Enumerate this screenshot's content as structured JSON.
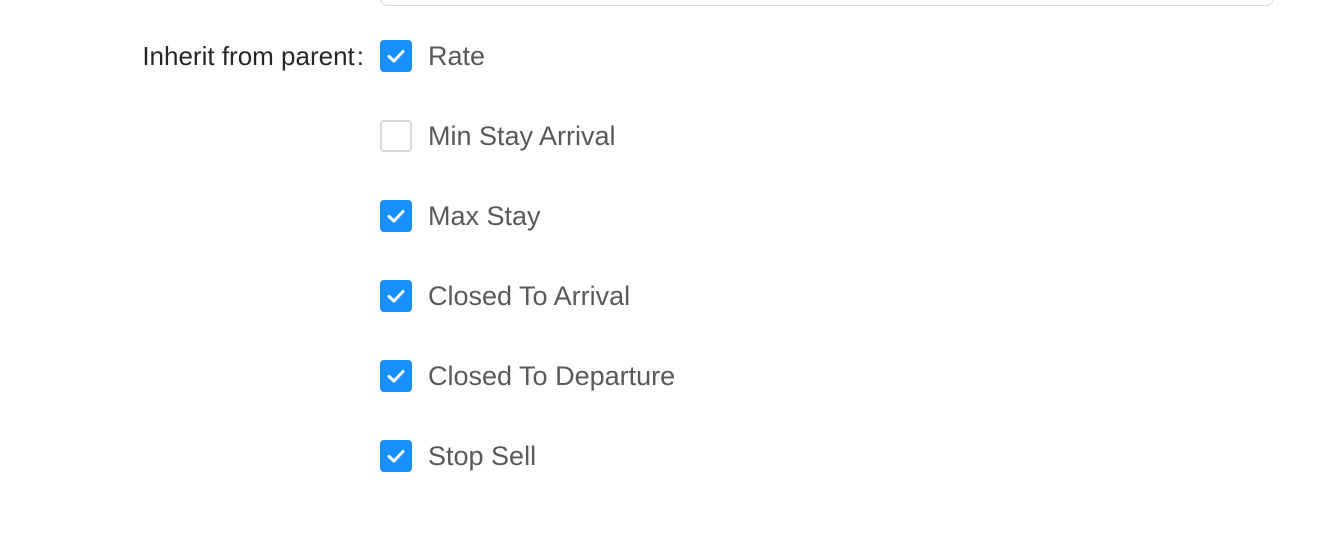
{
  "form": {
    "label": "Inherit from parent",
    "colon": ":"
  },
  "colors": {
    "accent": "#1890ff",
    "unchecked_border": "#d9d9d9",
    "label_text": "#595959"
  },
  "options": [
    {
      "label": "Rate",
      "checked": true
    },
    {
      "label": "Min Stay Arrival",
      "checked": false
    },
    {
      "label": "Max Stay",
      "checked": true
    },
    {
      "label": "Closed To Arrival",
      "checked": true
    },
    {
      "label": "Closed To Departure",
      "checked": true
    },
    {
      "label": "Stop Sell",
      "checked": true
    }
  ]
}
